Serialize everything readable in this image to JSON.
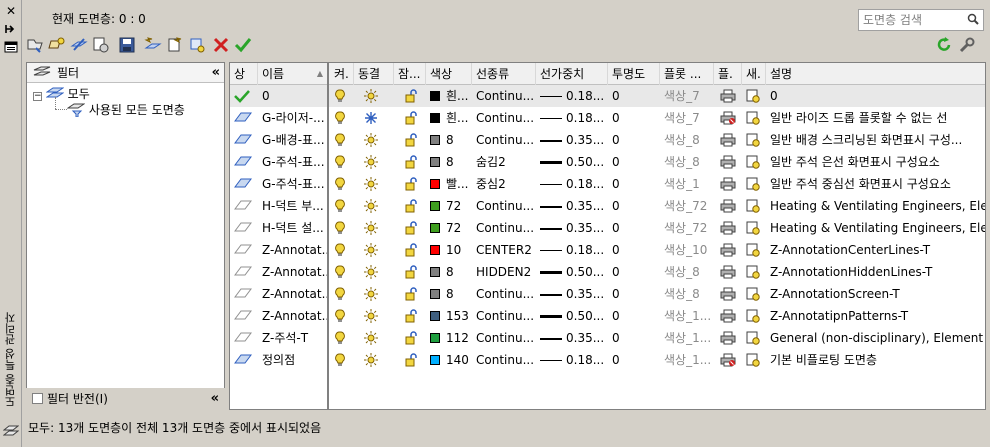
{
  "panel_title": "도면층 특성 관리자",
  "current_layer": "현재 도면층: 0 : 0",
  "search": {
    "placeholder": "도면층 검색"
  },
  "filter_panel": {
    "title": "필터",
    "tree": [
      {
        "label": "모두"
      },
      {
        "label": "사용된 모든 도면층"
      }
    ],
    "invert_label": "필터 반전(I)"
  },
  "columns": [
    "상",
    "이름",
    "켜.",
    "동결",
    "잠...",
    "색상",
    "선종류",
    "선가중치",
    "투명도",
    "플롯 ...",
    "플.",
    "새.",
    "설명"
  ],
  "layers": [
    {
      "status": "current",
      "name": "0",
      "on": true,
      "frozen": false,
      "locked": false,
      "color_name": "흰...",
      "color": "#000000",
      "linetype": "Continu...",
      "lineweight": "0.18...",
      "lw_weight": 1,
      "transparency": "0",
      "plot_style": "색상_7",
      "plot": true,
      "new_vp": true,
      "description": "0"
    },
    {
      "status": "layer",
      "name": "G-라이저-...",
      "on": true,
      "frozen": true,
      "locked": false,
      "color_name": "흰...",
      "color": "#000000",
      "linetype": "Continu...",
      "lineweight": "0.18...",
      "lw_weight": 1,
      "transparency": "0",
      "plot_style": "색상_7",
      "plot": false,
      "new_vp": true,
      "description": "일반 라이즈 드롭 플롯할 수 없는 선"
    },
    {
      "status": "layer",
      "name": "G-배경-표...",
      "on": true,
      "frozen": false,
      "locked": false,
      "color_name": "8",
      "color": "#808080",
      "linetype": "Continu...",
      "lineweight": "0.35...",
      "lw_weight": 2,
      "transparency": "0",
      "plot_style": "색상_8",
      "plot": true,
      "new_vp": true,
      "description": "일반 배경 스크리닝된 화면표시 구성..."
    },
    {
      "status": "layer",
      "name": "G-주석-표...",
      "on": true,
      "frozen": false,
      "locked": false,
      "color_name": "8",
      "color": "#808080",
      "linetype": "숨김2",
      "lineweight": "0.50...",
      "lw_weight": 3,
      "transparency": "0",
      "plot_style": "색상_8",
      "plot": true,
      "new_vp": true,
      "description": "일반 주석 은선 화면표시 구성요소"
    },
    {
      "status": "layer",
      "name": "G-주석-표...",
      "on": true,
      "frozen": false,
      "locked": false,
      "color_name": "빨...",
      "color": "#ff0000",
      "linetype": "중심2",
      "lineweight": "0.18...",
      "lw_weight": 1,
      "transparency": "0",
      "plot_style": "색상_1",
      "plot": true,
      "new_vp": true,
      "description": "일반 주석 중심선 화면표시 구성요소"
    },
    {
      "status": "layer-empty",
      "name": "H-덕트 부...",
      "on": true,
      "frozen": false,
      "locked": false,
      "color_name": "72",
      "color": "#3f9f1f",
      "linetype": "Continu...",
      "lineweight": "0.35...",
      "lw_weight": 2,
      "transparency": "0",
      "plot_style": "색상_72",
      "plot": true,
      "new_vp": true,
      "description": "Heating & Ventilating Engineers, Ele..."
    },
    {
      "status": "layer-empty",
      "name": "H-덕트 설...",
      "on": true,
      "frozen": false,
      "locked": false,
      "color_name": "72",
      "color": "#3f9f1f",
      "linetype": "Continu...",
      "lineweight": "0.35...",
      "lw_weight": 2,
      "transparency": "0",
      "plot_style": "색상_72",
      "plot": true,
      "new_vp": true,
      "description": "Heating & Ventilating Engineers, Ele..."
    },
    {
      "status": "layer-empty",
      "name": "Z-Annotat...",
      "on": true,
      "frozen": false,
      "locked": false,
      "color_name": "10",
      "color": "#ff0000",
      "linetype": "CENTER2",
      "lineweight": "0.18...",
      "lw_weight": 1,
      "transparency": "0",
      "plot_style": "색상_10",
      "plot": true,
      "new_vp": true,
      "description": "Z-AnnotationCenterLines-T"
    },
    {
      "status": "layer-empty",
      "name": "Z-Annotat...",
      "on": true,
      "frozen": false,
      "locked": false,
      "color_name": "8",
      "color": "#808080",
      "linetype": "HIDDEN2",
      "lineweight": "0.50...",
      "lw_weight": 3,
      "transparency": "0",
      "plot_style": "색상_8",
      "plot": true,
      "new_vp": true,
      "description": "Z-AnnotationHiddenLines-T"
    },
    {
      "status": "layer-empty",
      "name": "Z-Annotat...",
      "on": true,
      "frozen": false,
      "locked": false,
      "color_name": "8",
      "color": "#808080",
      "linetype": "Continu...",
      "lineweight": "0.35...",
      "lw_weight": 2,
      "transparency": "0",
      "plot_style": "색상_8",
      "plot": true,
      "new_vp": true,
      "description": "Z-AnnotationScreen-T"
    },
    {
      "status": "layer-empty",
      "name": "Z-Annotat...",
      "on": true,
      "frozen": false,
      "locked": false,
      "color_name": "153",
      "color": "#3f5f7f",
      "linetype": "Continu...",
      "lineweight": "0.50...",
      "lw_weight": 3,
      "transparency": "0",
      "plot_style": "색상_1...",
      "plot": true,
      "new_vp": true,
      "description": "Z-AnnotatipnPatterns-T"
    },
    {
      "status": "layer-empty",
      "name": "Z-주석-T",
      "on": true,
      "frozen": false,
      "locked": false,
      "color_name": "112",
      "color": "#1f9f3f",
      "linetype": "Continu...",
      "lineweight": "0.35...",
      "lw_weight": 2,
      "transparency": "0",
      "plot_style": "색상_1...",
      "plot": true,
      "new_vp": true,
      "description": "General (non-disciplinary), Element -..."
    },
    {
      "status": "layer",
      "name": "정의점",
      "on": true,
      "frozen": false,
      "locked": false,
      "color_name": "140",
      "color": "#00afff",
      "linetype": "Continu...",
      "lineweight": "0.18...",
      "lw_weight": 1,
      "transparency": "0",
      "plot_style": "색상_1...",
      "plot": false,
      "new_vp": true,
      "description": "기본 비플로팅 도면층"
    }
  ],
  "status_bar": "모두: 13개 도면층이 전체 13개 도면층 중에서 표시되었음",
  "colors": {
    "accent_blue": "#2f5fbf",
    "check_green": "#2aa52a",
    "delete_red": "#d02020",
    "bulb_yellow": "#f2d640"
  }
}
